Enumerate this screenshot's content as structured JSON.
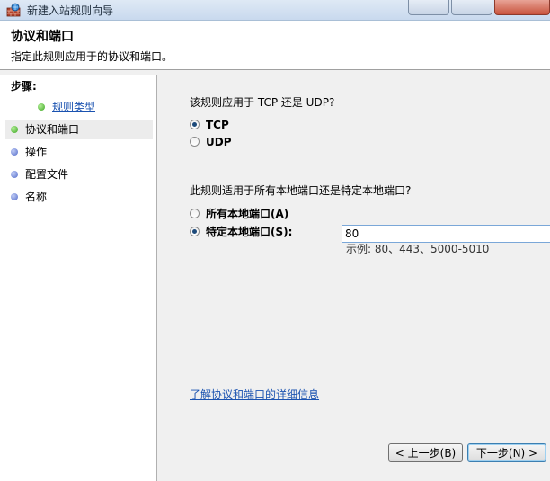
{
  "window": {
    "title": "新建入站规则向导",
    "icon": "firewall-wizard-icon"
  },
  "header": {
    "title": "协议和端口",
    "subtitle": "指定此规则应用于的协议和端口。"
  },
  "steps": {
    "heading": "步骤:",
    "items": [
      {
        "label": "规则类型",
        "state": "done"
      },
      {
        "label": "协议和端口",
        "state": "current"
      },
      {
        "label": "操作",
        "state": "pending"
      },
      {
        "label": "配置文件",
        "state": "pending"
      },
      {
        "label": "名称",
        "state": "pending"
      }
    ]
  },
  "protocol": {
    "question": "该规则应用于 TCP 还是 UDP?",
    "options": [
      {
        "label": "TCP",
        "selected": true
      },
      {
        "label": "UDP",
        "selected": false
      }
    ]
  },
  "ports": {
    "question": "此规则适用于所有本地端口还是特定本地端口?",
    "all_label": "所有本地端口(A)",
    "specific_label": "特定本地端口(S):",
    "specific_selected": true,
    "value": "80",
    "example": "示例: 80、443、5000-5010"
  },
  "help_link": "了解协议和端口的详细信息",
  "buttons": {
    "back": "< 上一步(B)",
    "next": "下一步(N) >"
  },
  "colors": {
    "link": "#1a52b0",
    "done_dot": "#3aa521",
    "pending_dot": "#5069c8"
  }
}
